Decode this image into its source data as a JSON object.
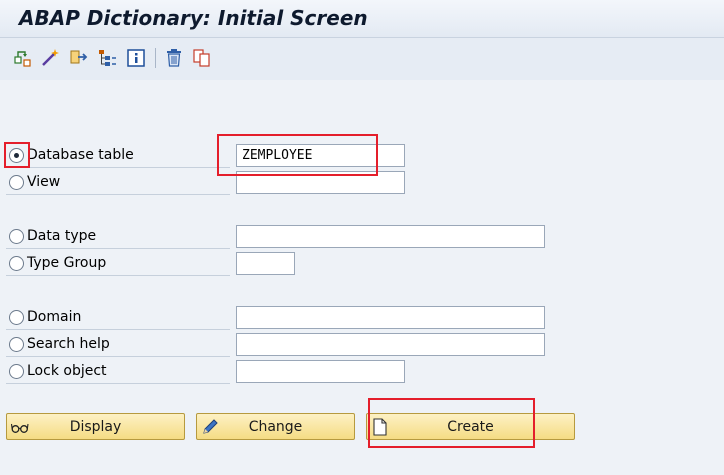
{
  "window": {
    "title": "ABAP Dictionary: Initial Screen"
  },
  "toolbar": {
    "icons": [
      "other-object-icon",
      "magic-wand-icon",
      "transport-icon",
      "hierarchy-icon",
      "info-icon",
      "delete-icon",
      "copy-icon"
    ]
  },
  "form": {
    "options": [
      {
        "label": "Database table",
        "selected": true,
        "value": "ZEMPLOYEE"
      },
      {
        "label": "View",
        "selected": false,
        "value": ""
      },
      {
        "label": "Data type",
        "selected": false,
        "value": ""
      },
      {
        "label": "Type Group",
        "selected": false,
        "value": ""
      },
      {
        "label": "Domain",
        "selected": false,
        "value": ""
      },
      {
        "label": "Search help",
        "selected": false,
        "value": ""
      },
      {
        "label": "Lock object",
        "selected": false,
        "value": ""
      }
    ]
  },
  "buttons": {
    "display": "Display",
    "change": "Change",
    "create": "Create"
  },
  "colors": {
    "highlight": "#e41e2b",
    "button_fill": "#f5dc84",
    "background": "#eef2f7"
  }
}
